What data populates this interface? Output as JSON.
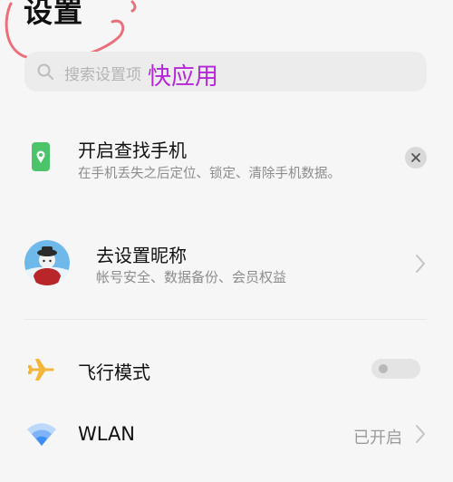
{
  "header": {
    "title": "设置"
  },
  "search": {
    "placeholder": "搜索设置项",
    "annotation": "快应用"
  },
  "find_phone": {
    "title": "开启查找手机",
    "description": "在手机丢失之后定位、锁定、清除手机数据。",
    "icon": "find-phone-icon"
  },
  "account": {
    "title": "去设置昵称",
    "description": "帐号安全、数据备份、会员权益",
    "icon": "avatar"
  },
  "settings": {
    "airplane": {
      "label": "飞行模式",
      "enabled": false,
      "icon": "airplane-icon"
    },
    "wlan": {
      "label": "WLAN",
      "status": "已开启",
      "icon": "wifi-icon"
    }
  },
  "colors": {
    "background": "#f6f6f6",
    "annotation": "#b526d8",
    "scribble": "#e9707a",
    "find_phone_green": "#4cc46a",
    "airplane_orange": "#f2b63a",
    "wifi_blue": "#3d8df2"
  }
}
